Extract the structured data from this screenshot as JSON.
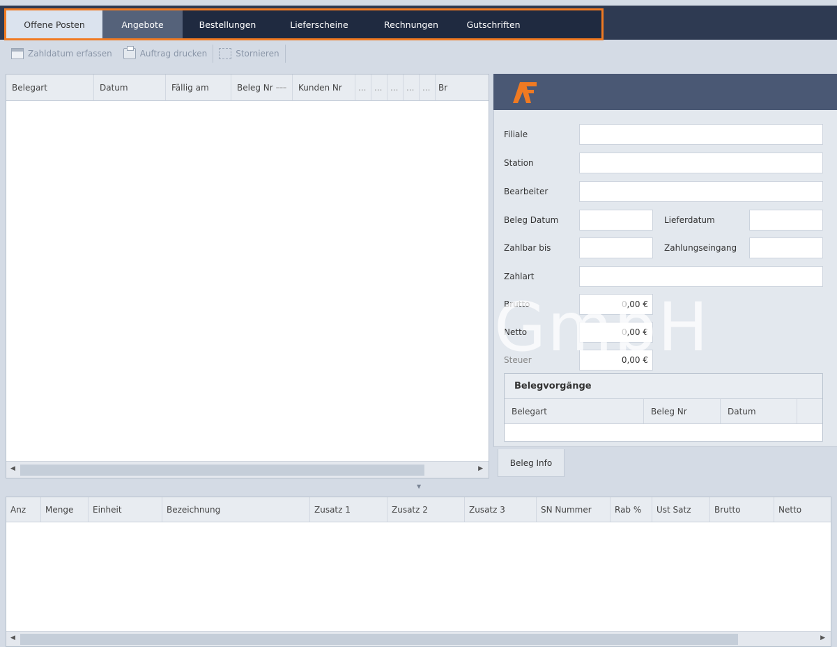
{
  "tabs": [
    {
      "label": "Offene Posten"
    },
    {
      "label": "Angebote"
    },
    {
      "label": "Bestellungen"
    },
    {
      "label": "Lieferscheine"
    },
    {
      "label": "Rechnungen"
    },
    {
      "label": "Gutschriften"
    }
  ],
  "toolbar": {
    "zahldatum": "Zahldatum erfassen",
    "drucken": "Auftrag drucken",
    "stornieren": "Stornieren"
  },
  "left_grid": {
    "columns": [
      "Belegart",
      "Datum",
      "Fällig am",
      "Beleg Nr",
      "Kunden Nr",
      "...",
      "...",
      "...",
      "...",
      "...",
      "Br"
    ]
  },
  "info_panel": {
    "logo_text": "AF",
    "watermark": "GmbH",
    "labels": {
      "filiale": "Filiale",
      "station": "Station",
      "bearbeiter": "Bearbeiter",
      "beleg_datum": "Beleg Datum",
      "lieferdatum": "Lieferdatum",
      "zahlbar_bis": "Zahlbar bis",
      "zahlungseingang": "Zahlungseingang",
      "zahlart": "Zahlart",
      "brutto": "Brutto",
      "netto": "Netto",
      "steuer": "Steuer"
    },
    "values": {
      "brutto": "0,00 €",
      "netto": "0,00 €",
      "steuer": "0,00 €"
    },
    "belegvorgaenge": {
      "title": "Belegvorgänge",
      "columns": [
        "Belegart",
        "Beleg Nr",
        "Datum"
      ]
    },
    "tab_label": "Beleg Info"
  },
  "bottom_grid": {
    "columns": [
      "Anz",
      "Menge",
      "Einheit",
      "Bezeichnung",
      "Zusatz 1",
      "Zusatz 2",
      "Zusatz 3",
      "SN Nummer",
      "Rab %",
      "Ust Satz",
      "Brutto",
      "Netto"
    ]
  },
  "colors": {
    "accent_orange": "#f07a22",
    "header_dark": "#2e3a52",
    "panel_header": "#4a5874"
  }
}
